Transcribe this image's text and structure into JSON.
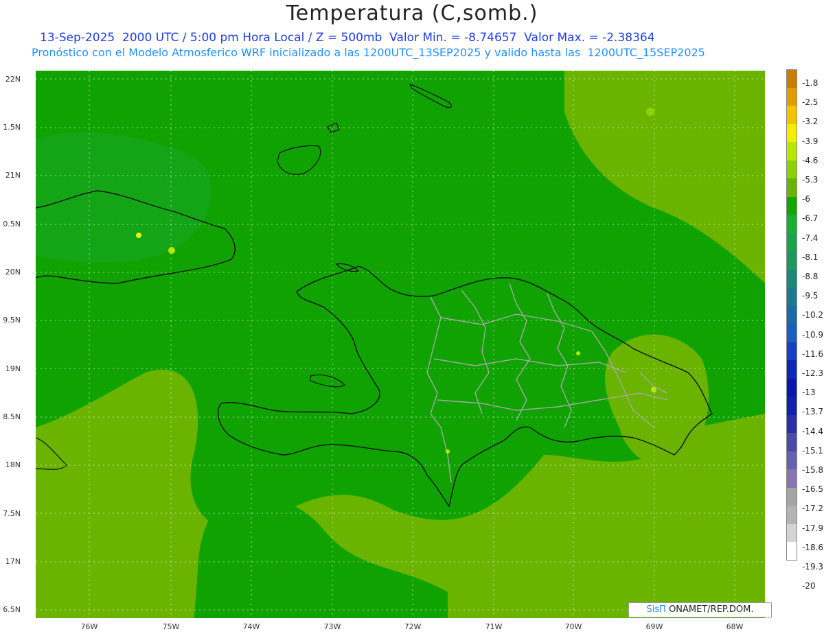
{
  "title": "Temperatura (C,somb.)",
  "subtitle1": "13-Sep-2025  2000 UTC / 5:00 pm Hora Local / Z = 500mb  Valor Min. = -8.74657  Valor Max. = -2.38364",
  "subtitle2": "Pronóstico con el Modelo Atmosferico WRF inicializado a las 1200UTC_13SEP2025 y valido hasta las  1200UTC_15SEP2025",
  "lat_labels": [
    "22N",
    "1.5N",
    "21N",
    "0.5N",
    "20N",
    "9.5N",
    "19N",
    "8.5N",
    "18N",
    "7.5N",
    "17N",
    "6.5N"
  ],
  "lon_labels": [
    "76W",
    "75W",
    "74W",
    "73W",
    "72W",
    "71W",
    "70W",
    "69W",
    "68W"
  ],
  "colorbar": {
    "labels": [
      "-1.8",
      "-2.5",
      "-3.2",
      "-3.9",
      "-4.6",
      "-5.3",
      "-6",
      "-6.7",
      "-7.4",
      "-8.1",
      "-8.8",
      "-9.5",
      "-10.2",
      "-10.9",
      "-11.6",
      "-12.3",
      "-13",
      "-13.7",
      "-14.4",
      "-15.1",
      "-15.8",
      "-16.5",
      "-17.2",
      "-17.9",
      "-18.6",
      "-19.3",
      "-20"
    ],
    "colors": [
      "#c87f00",
      "#e09c00",
      "#f4c400",
      "#f2f000",
      "#b8e800",
      "#8cd200",
      "#6ab400",
      "#10a800",
      "#18b030",
      "#19a34a",
      "#1d9860",
      "#1a8a78",
      "#1a7a90",
      "#1b6aa8",
      "#1a5fc0",
      "#1340c4",
      "#0c28b8",
      "#0a14b0",
      "#1020b0",
      "#2a2ea8",
      "#4a4aa8",
      "#6860b0",
      "#8676b4",
      "#a4a4a4",
      "#b4b4b4",
      "#d4d4d4",
      "#ffffff"
    ]
  },
  "credit": {
    "brand": "SisΠ",
    "text": " ONAMET/REP.DOM."
  },
  "colors": {
    "land_outline": "#111111",
    "province_lines": "#a8a8a8",
    "field_dark": "#10a200",
    "field_light": "#6ab400"
  }
}
